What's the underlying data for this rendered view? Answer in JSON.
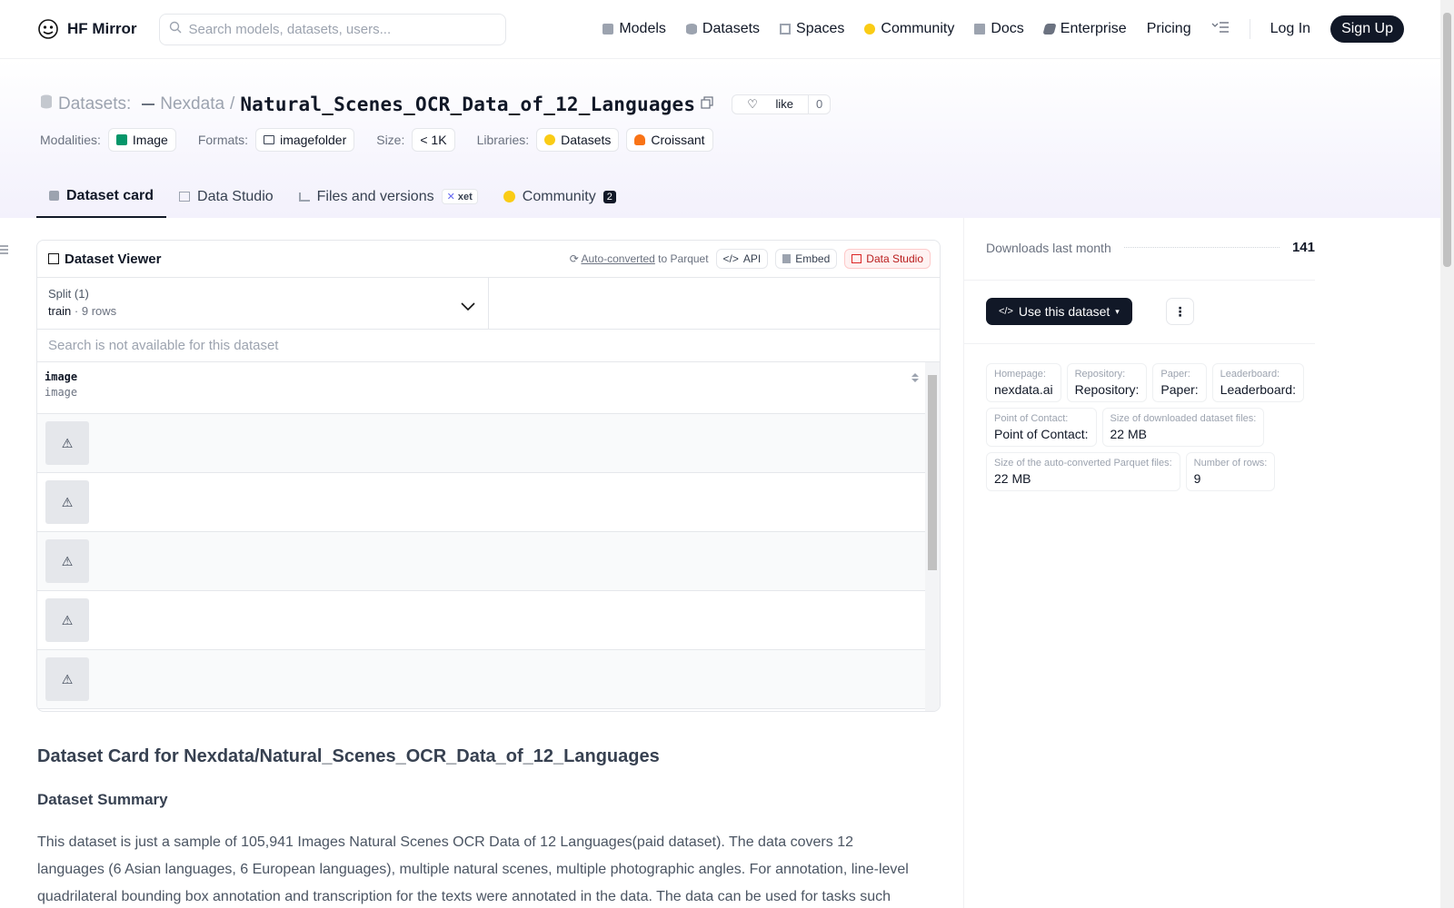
{
  "nav": {
    "brand": "HF Mirror",
    "search_placeholder": "Search models, datasets, users...",
    "links": [
      {
        "label": "Models",
        "icon": "cube-icon"
      },
      {
        "label": "Datasets",
        "icon": "database-icon"
      },
      {
        "label": "Spaces",
        "icon": "grid-icon"
      },
      {
        "label": "Community",
        "icon": "hug-icon"
      },
      {
        "label": "Docs",
        "icon": "book-icon"
      },
      {
        "label": "Enterprise",
        "icon": "enterprise-icon"
      },
      {
        "label": "Pricing",
        "icon": ""
      }
    ],
    "login": "Log In",
    "signup": "Sign Up"
  },
  "header": {
    "kind": "Datasets:",
    "org": "Nexdata",
    "slash": "/",
    "repo": "Natural_Scenes_OCR_Data_of_12_Languages",
    "like_label": "like",
    "like_count": "0",
    "modalities_label": "Modalities:",
    "modality": "Image",
    "formats_label": "Formats:",
    "format": "imagefolder",
    "size_label": "Size:",
    "size": "< 1K",
    "libraries_label": "Libraries:",
    "libraries": [
      "Datasets",
      "Croissant"
    ]
  },
  "tabs": [
    {
      "label": "Dataset card",
      "active": true
    },
    {
      "label": "Data Studio"
    },
    {
      "label": "Files and versions",
      "tag": "xet"
    },
    {
      "label": "Community",
      "count": "2"
    }
  ],
  "viewer": {
    "title": "Dataset Viewer",
    "auto_converted": "Auto-converted",
    "to_parquet": "to Parquet",
    "api": "API",
    "embed": "Embed",
    "data_studio": "Data Studio",
    "split_label": "Split (1)",
    "split_name": "train",
    "split_dot": "·",
    "split_rows": "9 rows",
    "search_na": "Search is not available for this dataset",
    "column_name": "image",
    "column_type": "image",
    "row_placeholder": "⚠"
  },
  "card": {
    "title": "Dataset Card for Nexdata/Natural_Scenes_OCR_Data_of_12_Languages",
    "summary_heading": "Dataset Summary",
    "summary_text": "This dataset is just a sample of 105,941 Images Natural Scenes OCR Data of 12 Languages(paid dataset). The data covers 12 languages (6 Asian languages, 6 European languages), multiple natural scenes, multiple photographic angles. For annotation, line-level quadrilateral bounding box annotation and transcription for the texts were annotated in the data. The data can be used for tasks such"
  },
  "sidebar": {
    "downloads_label": "Downloads last month",
    "downloads": "141",
    "use_button": "Use this dataset",
    "info": [
      {
        "k": "Homepage:",
        "v": "nexdata.ai"
      },
      {
        "k": "Repository:",
        "v": "Repository:"
      },
      {
        "k": "Paper:",
        "v": "Paper:"
      },
      {
        "k": "Leaderboard:",
        "v": "Leaderboard:"
      },
      {
        "k": "Point of Contact:",
        "v": "Point of Contact:"
      },
      {
        "k": "Size of downloaded dataset files:",
        "v": "22 MB"
      },
      {
        "k": "Size of the auto-converted Parquet files:",
        "v": "22 MB"
      },
      {
        "k": "Number of rows:",
        "v": "9"
      }
    ]
  },
  "colors": {
    "accent_dark": "#111827",
    "studio_red": "#b91c1c"
  }
}
